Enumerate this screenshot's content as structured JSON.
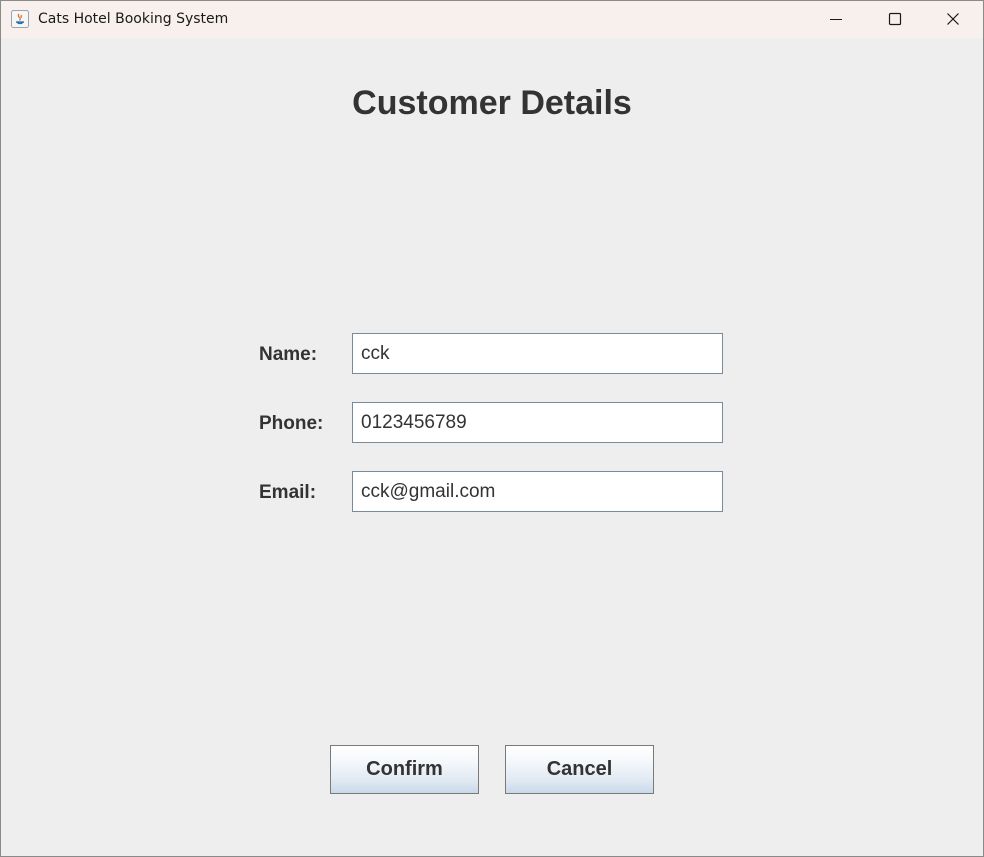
{
  "window": {
    "title": "Cats Hotel Booking System",
    "app_icon": "java-icon",
    "controls": [
      "minimize-icon",
      "maximize-icon",
      "close-icon"
    ]
  },
  "form": {
    "heading": "Customer Details",
    "fields": [
      {
        "label": "Name:",
        "value": "cck"
      },
      {
        "label": "Phone:",
        "value": "0123456789"
      },
      {
        "label": "Email:",
        "value": "cck@gmail.com"
      }
    ]
  },
  "actions": {
    "confirm_label": "Confirm",
    "cancel_label": "Cancel"
  },
  "colors": {
    "background": "#eeeeee",
    "titlebar": "#f8f0ec",
    "text": "#333333",
    "input_border": "#7a8a9c"
  }
}
